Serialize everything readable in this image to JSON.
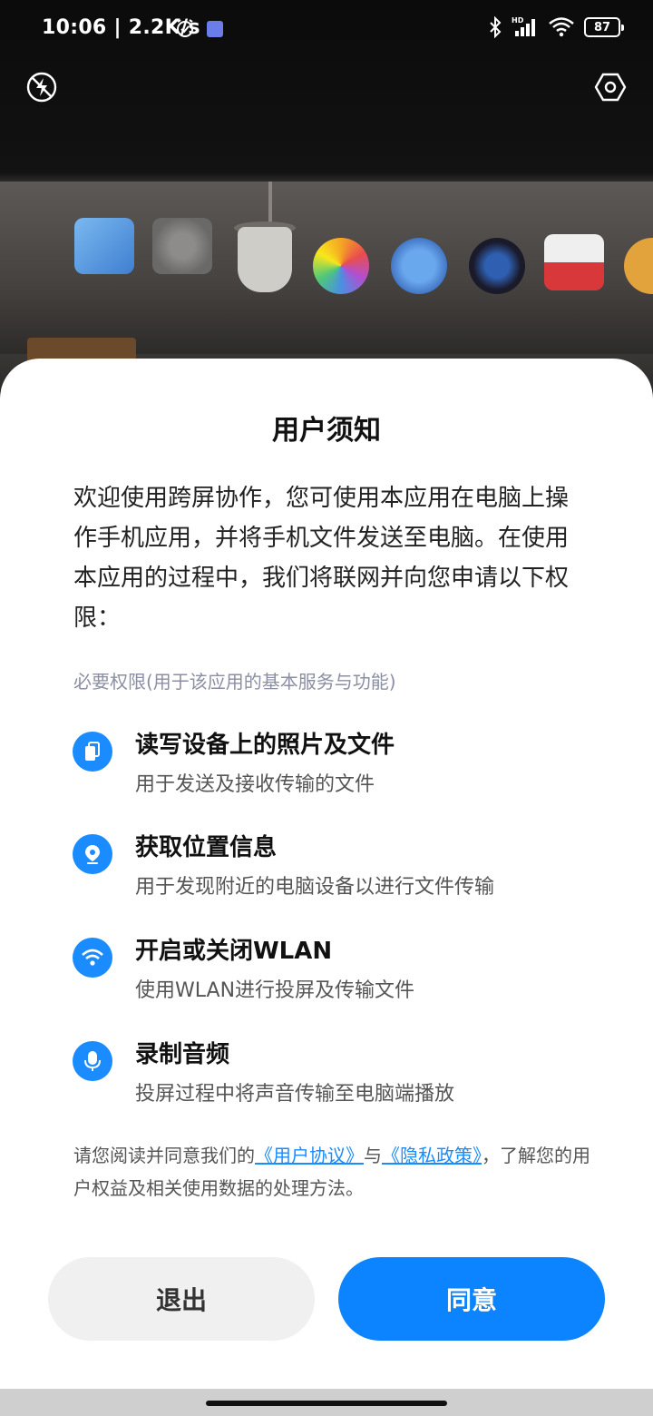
{
  "status_bar": {
    "time": "10:06",
    "network_speed": "2.2K/s",
    "battery_level": "87",
    "icons": [
      "alarm-icon",
      "app-notification-icon",
      "bluetooth-icon",
      "signal-hd-icon",
      "wifi-icon",
      "battery-icon"
    ]
  },
  "camera": {
    "flash_icon": "flash-off-icon",
    "settings_icon": "hexagon-settings-icon"
  },
  "dialog": {
    "title": "用户须知",
    "intro": "欢迎使用跨屏协作，您可使用本应用在电脑上操作手机应用，并将手机文件发送至电脑。在使用本应用的过程中，我们将联网并向您申请以下权限：",
    "section_label": "必要权限(用于该应用的基本服务与功能)",
    "permissions": [
      {
        "icon": "file-icon",
        "title": "读写设备上的照片及文件",
        "desc": "用于发送及接收传输的文件"
      },
      {
        "icon": "location-icon",
        "title": "获取位置信息",
        "desc": "用于发现附近的电脑设备以进行文件传输"
      },
      {
        "icon": "wifi-icon",
        "title": "开启或关闭WLAN",
        "desc": "使用WLAN进行投屏及传输文件"
      },
      {
        "icon": "microphone-icon",
        "title": "录制音频",
        "desc": "投屏过程中将声音传输至电脑端播放"
      }
    ],
    "agreement": {
      "prefix": "请您阅读并同意我们的",
      "user_agreement": "《用户协议》",
      "and": "与",
      "privacy_policy": "《隐私政策》",
      "suffix": "，了解您的用户权益及相关使用数据的处理方法。"
    },
    "buttons": {
      "exit": "退出",
      "agree": "同意"
    },
    "colors": {
      "accent": "#0d84ff",
      "secondary_button": "#f0f0f0",
      "section_label": "#8a8fa3"
    }
  }
}
